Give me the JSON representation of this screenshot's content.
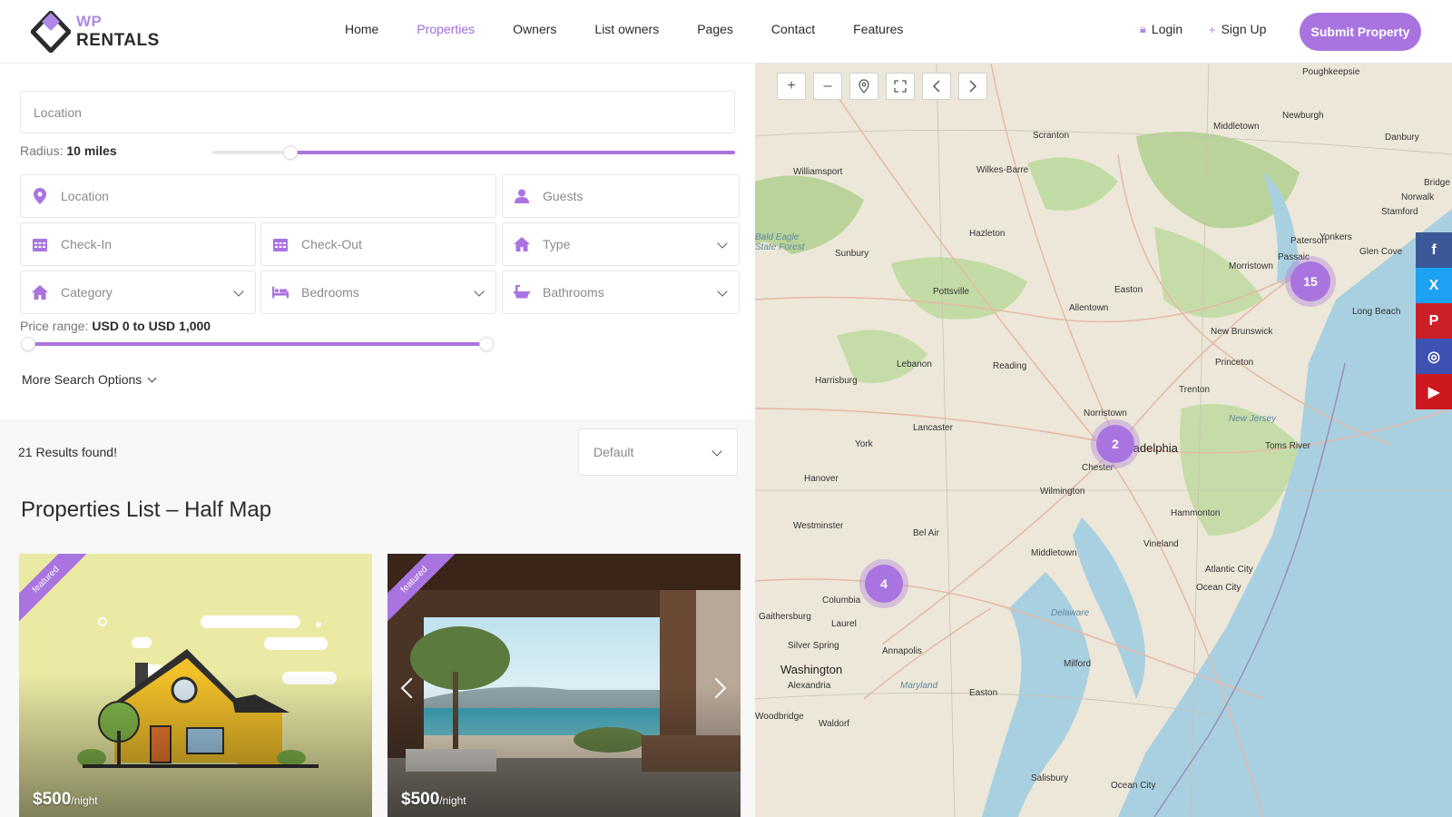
{
  "brand": {
    "line1": "WP",
    "line2": "RENTALS",
    "accent": "#a974e0"
  },
  "nav": [
    {
      "label": "Home",
      "active": false
    },
    {
      "label": "Properties",
      "active": true
    },
    {
      "label": "Owners",
      "active": false
    },
    {
      "label": "List owners",
      "active": false
    },
    {
      "label": "Pages",
      "active": false
    },
    {
      "label": "Contact",
      "active": false
    },
    {
      "label": "Features",
      "active": false
    }
  ],
  "auth": {
    "login": "Login",
    "signup": "Sign Up"
  },
  "submit_label": "Submit Property",
  "search": {
    "location_placeholder": "Location",
    "radius_label": "Radius:",
    "radius_value": "10 miles",
    "radius_fraction": 0.15,
    "location2_placeholder": "Location",
    "guests_placeholder": "Guests",
    "checkin_placeholder": "Check-In",
    "checkout_placeholder": "Check-Out",
    "type_placeholder": "Type",
    "category_placeholder": "Category",
    "bedrooms_placeholder": "Bedrooms",
    "bathrooms_placeholder": "Bathrooms",
    "price_label": "Price range:",
    "price_value": "USD 0 to USD 1,000",
    "more_options": "More Search Options"
  },
  "results": {
    "count_text": "21 Results found!",
    "sort_value": "Default",
    "list_title": "Properties List – Half Map"
  },
  "cards": [
    {
      "badge": "featured",
      "price": "$500",
      "unit": "/night"
    },
    {
      "badge": "featured",
      "price": "$500",
      "unit": "/night"
    }
  ],
  "map": {
    "clusters": [
      "15",
      "2",
      "4"
    ],
    "places": [
      "Poughkeepsie",
      "Middletown",
      "Newburgh",
      "Danbury",
      "Scranton",
      "Williamsport",
      "Wilkes-Barre",
      "Norwalk",
      "Stamford",
      "Bridge",
      "Hazleton",
      "Bald Eagle State Forest",
      "Sunbury",
      "Yonkers",
      "Paterson",
      "Glen Cove",
      "Morristown",
      "Passaic",
      "Long Beach",
      "Pottsville",
      "Easton",
      "Allentown",
      "New Brunswick",
      "Lebanon",
      "Reading",
      "Princeton",
      "Harrisburg",
      "Trenton",
      "Norristown",
      "New Jersey",
      "Lancaster",
      "Toms River",
      "York",
      "Philadelphia",
      "Chester",
      "Hanover",
      "Wilmington",
      "Hammonton",
      "Westminster",
      "Bel Air",
      "Vineland",
      "Middletown",
      "Atlantic City",
      "Ocean City",
      "Columbia",
      "Gaithersburg",
      "Laurel",
      "Delaware",
      "Silver Spring",
      "Annapolis",
      "Washington",
      "Alexandria",
      "Milford",
      "Maryland",
      "Easton",
      "Woodbridge",
      "Waldorf",
      "Salisbury",
      "Ocean City"
    ]
  },
  "social": [
    {
      "icon": "facebook-icon",
      "glyph": "f",
      "color": "#3b5998"
    },
    {
      "icon": "x-icon",
      "glyph": "X",
      "color": "#1da1f2"
    },
    {
      "icon": "pinterest-icon",
      "glyph": "P",
      "color": "#cb2027"
    },
    {
      "icon": "instagram-icon",
      "glyph": "◎",
      "color": "#3f51b5"
    },
    {
      "icon": "youtube-icon",
      "glyph": "▶",
      "color": "#cc181e"
    }
  ]
}
